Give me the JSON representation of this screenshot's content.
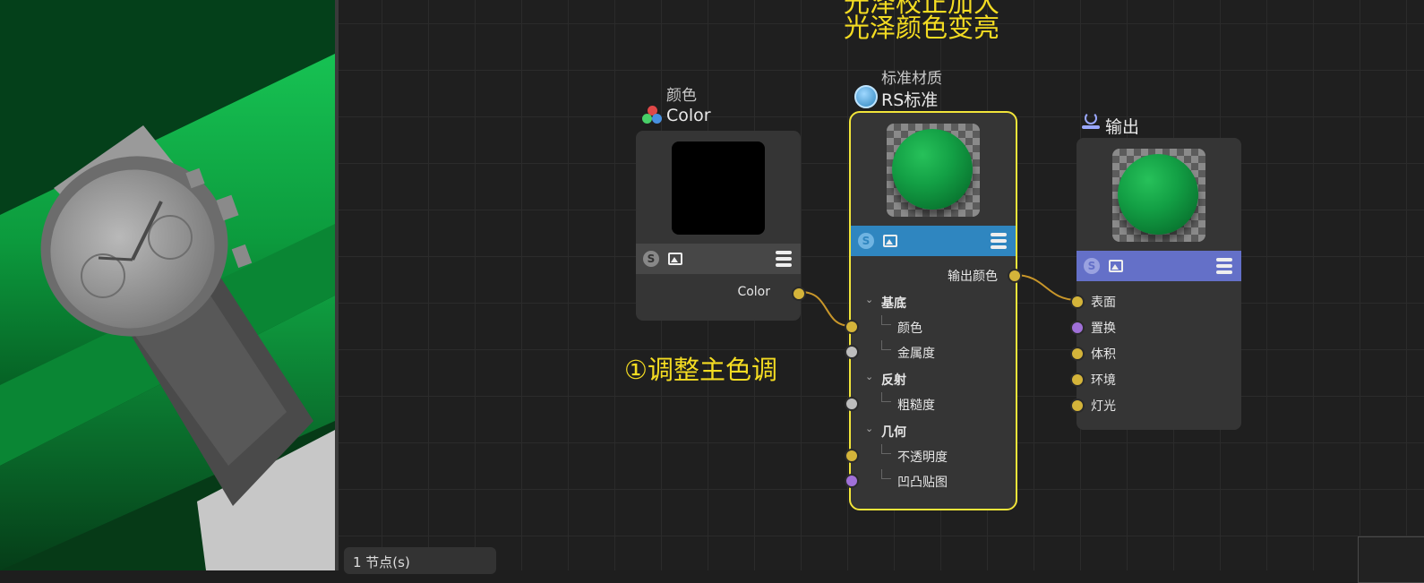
{
  "color_node": {
    "subtitle": "颜色",
    "title": "Color",
    "output_label": "Color",
    "swatch_color": "#000000"
  },
  "material_node": {
    "subtitle": "标准材质",
    "title": "RS标准",
    "output_label": "输出颜色",
    "groups": [
      {
        "label": "基底",
        "ports": [
          "颜色",
          "金属度"
        ]
      },
      {
        "label": "反射",
        "ports": [
          "粗糙度"
        ]
      },
      {
        "label": "几何",
        "ports": [
          "不透明度",
          "凹凸贴图"
        ]
      }
    ]
  },
  "output_node": {
    "title": "输出",
    "inputs": [
      "表面",
      "置换",
      "体积",
      "环境",
      "灯光"
    ]
  },
  "annotations": {
    "top_line_partial": "光泽校正加大",
    "top_line2": "光泽颜色变亮",
    "step1": "①调整主色调"
  },
  "status_bar": {
    "text": "1 节点(s)"
  },
  "colors": {
    "accent_yellow": "#f4dc22",
    "selection_outline": "#f2e53a",
    "material_bar": "#2f86c0",
    "output_bar": "#6470c8",
    "port_yellow": "#d4b43a",
    "port_white": "#bdbdbd",
    "port_purple": "#a070d8",
    "wire": "#c8962a"
  }
}
